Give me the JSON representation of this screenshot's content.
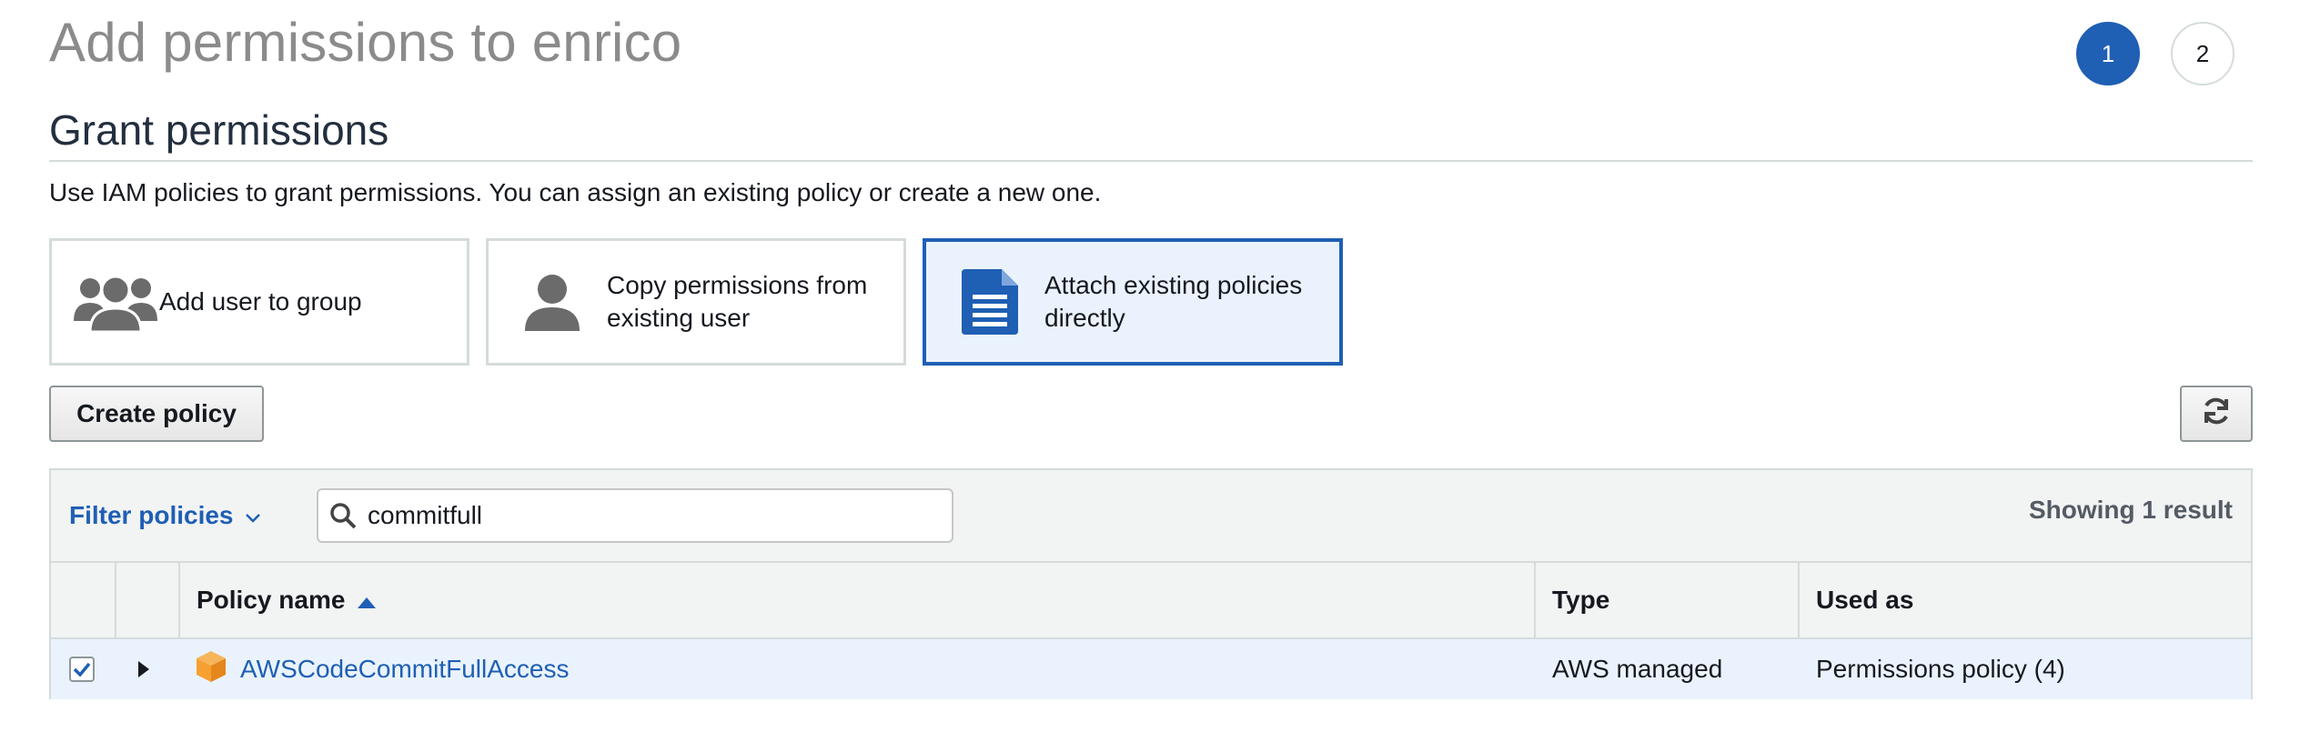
{
  "page": {
    "title": "Add permissions to enrico",
    "steps": [
      "1",
      "2"
    ],
    "active_step": "1"
  },
  "grant": {
    "title": "Grant permissions",
    "description": "Use IAM policies to grant permissions. You can assign an existing policy or create a new one.",
    "options": [
      {
        "label": "Add user to group",
        "icon": "user-group-icon",
        "selected": false
      },
      {
        "label": "Copy permissions from existing user",
        "label_line1": "Copy permissions from",
        "label_line2": "existing user",
        "icon": "user-icon",
        "selected": false
      },
      {
        "label": "Attach existing policies directly",
        "label_line1": "Attach existing policies",
        "label_line2": "directly",
        "icon": "document-icon",
        "selected": true
      }
    ]
  },
  "toolbar": {
    "create_policy_label": "Create policy",
    "refresh_icon": "refresh-icon"
  },
  "filter": {
    "label": "Filter policies",
    "search_value": "commitfull",
    "result_text": "Showing 1 result"
  },
  "table": {
    "columns": [
      "Policy name",
      "Type",
      "Used as"
    ],
    "sort_column": "Policy name",
    "sort_direction": "ascending",
    "rows": [
      {
        "checked": true,
        "name": "AWSCodeCommitFullAccess",
        "type": "AWS managed",
        "used_as": "Permissions policy (4)"
      }
    ]
  },
  "colors": {
    "accent": "#1f5fb4",
    "selected_bg": "#eaf3fd",
    "title_gray": "#8b8b8b",
    "policy_icon": "#f7a032"
  }
}
